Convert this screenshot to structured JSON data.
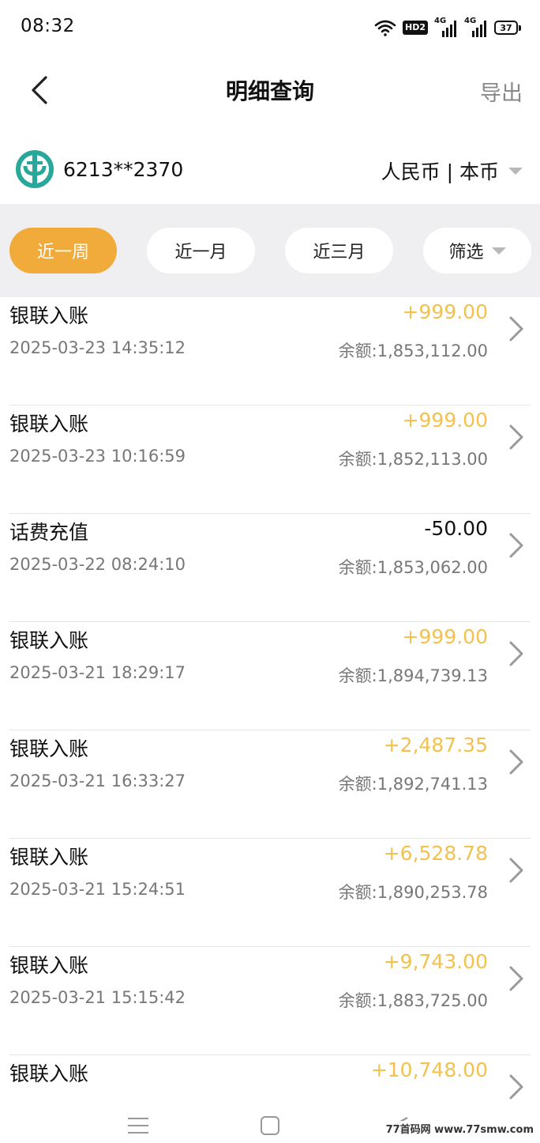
{
  "status_bar": {
    "time": "08:32",
    "hd_label": "HD2",
    "network_1": "4G",
    "network_2": "4G",
    "battery": "37"
  },
  "header": {
    "title": "明细查询",
    "export_label": "导出"
  },
  "account": {
    "logo_icon": "agricultural-bank-logo-icon",
    "logo_color": "#2aa79b",
    "number": "6213**2370",
    "currency_label": "人民币 | 本币"
  },
  "filters": [
    {
      "label": "近一周",
      "active": true
    },
    {
      "label": "近一月",
      "active": false
    },
    {
      "label": "近三月",
      "active": false
    },
    {
      "label": "筛选",
      "active": false
    }
  ],
  "colors": {
    "accent": "#f0ab3a",
    "income": "#f2c14e",
    "expense": "#111111"
  },
  "transactions": [
    {
      "title": "银联入账",
      "time": "2025-03-23 14:35:12",
      "amount": "+999.00",
      "balance": "余额:1,853,112.00",
      "type": "income"
    },
    {
      "title": "银联入账",
      "time": "2025-03-23 10:16:59",
      "amount": "+999.00",
      "balance": "余额:1,852,113.00",
      "type": "income"
    },
    {
      "title": "话费充值",
      "time": "2025-03-22 08:24:10",
      "amount": "-50.00",
      "balance": "余额:1,853,062.00",
      "type": "expense"
    },
    {
      "title": "银联入账",
      "time": "2025-03-21 18:29:17",
      "amount": "+999.00",
      "balance": "余额:1,894,739.13",
      "type": "income"
    },
    {
      "title": "银联入账",
      "time": "2025-03-21 16:33:27",
      "amount": "+2,487.35",
      "balance": "余额:1,892,741.13",
      "type": "income"
    },
    {
      "title": "银联入账",
      "time": "2025-03-21 15:24:51",
      "amount": "+6,528.78",
      "balance": "余额:1,890,253.78",
      "type": "income"
    },
    {
      "title": "银联入账",
      "time": "2025-03-21 15:15:42",
      "amount": "+9,743.00",
      "balance": "余额:1,883,725.00",
      "type": "income"
    },
    {
      "title": "银联入账",
      "time": "",
      "amount": "+10,748.00",
      "balance": "",
      "type": "income"
    }
  ],
  "watermark": "77首码网 www.77smw.com"
}
